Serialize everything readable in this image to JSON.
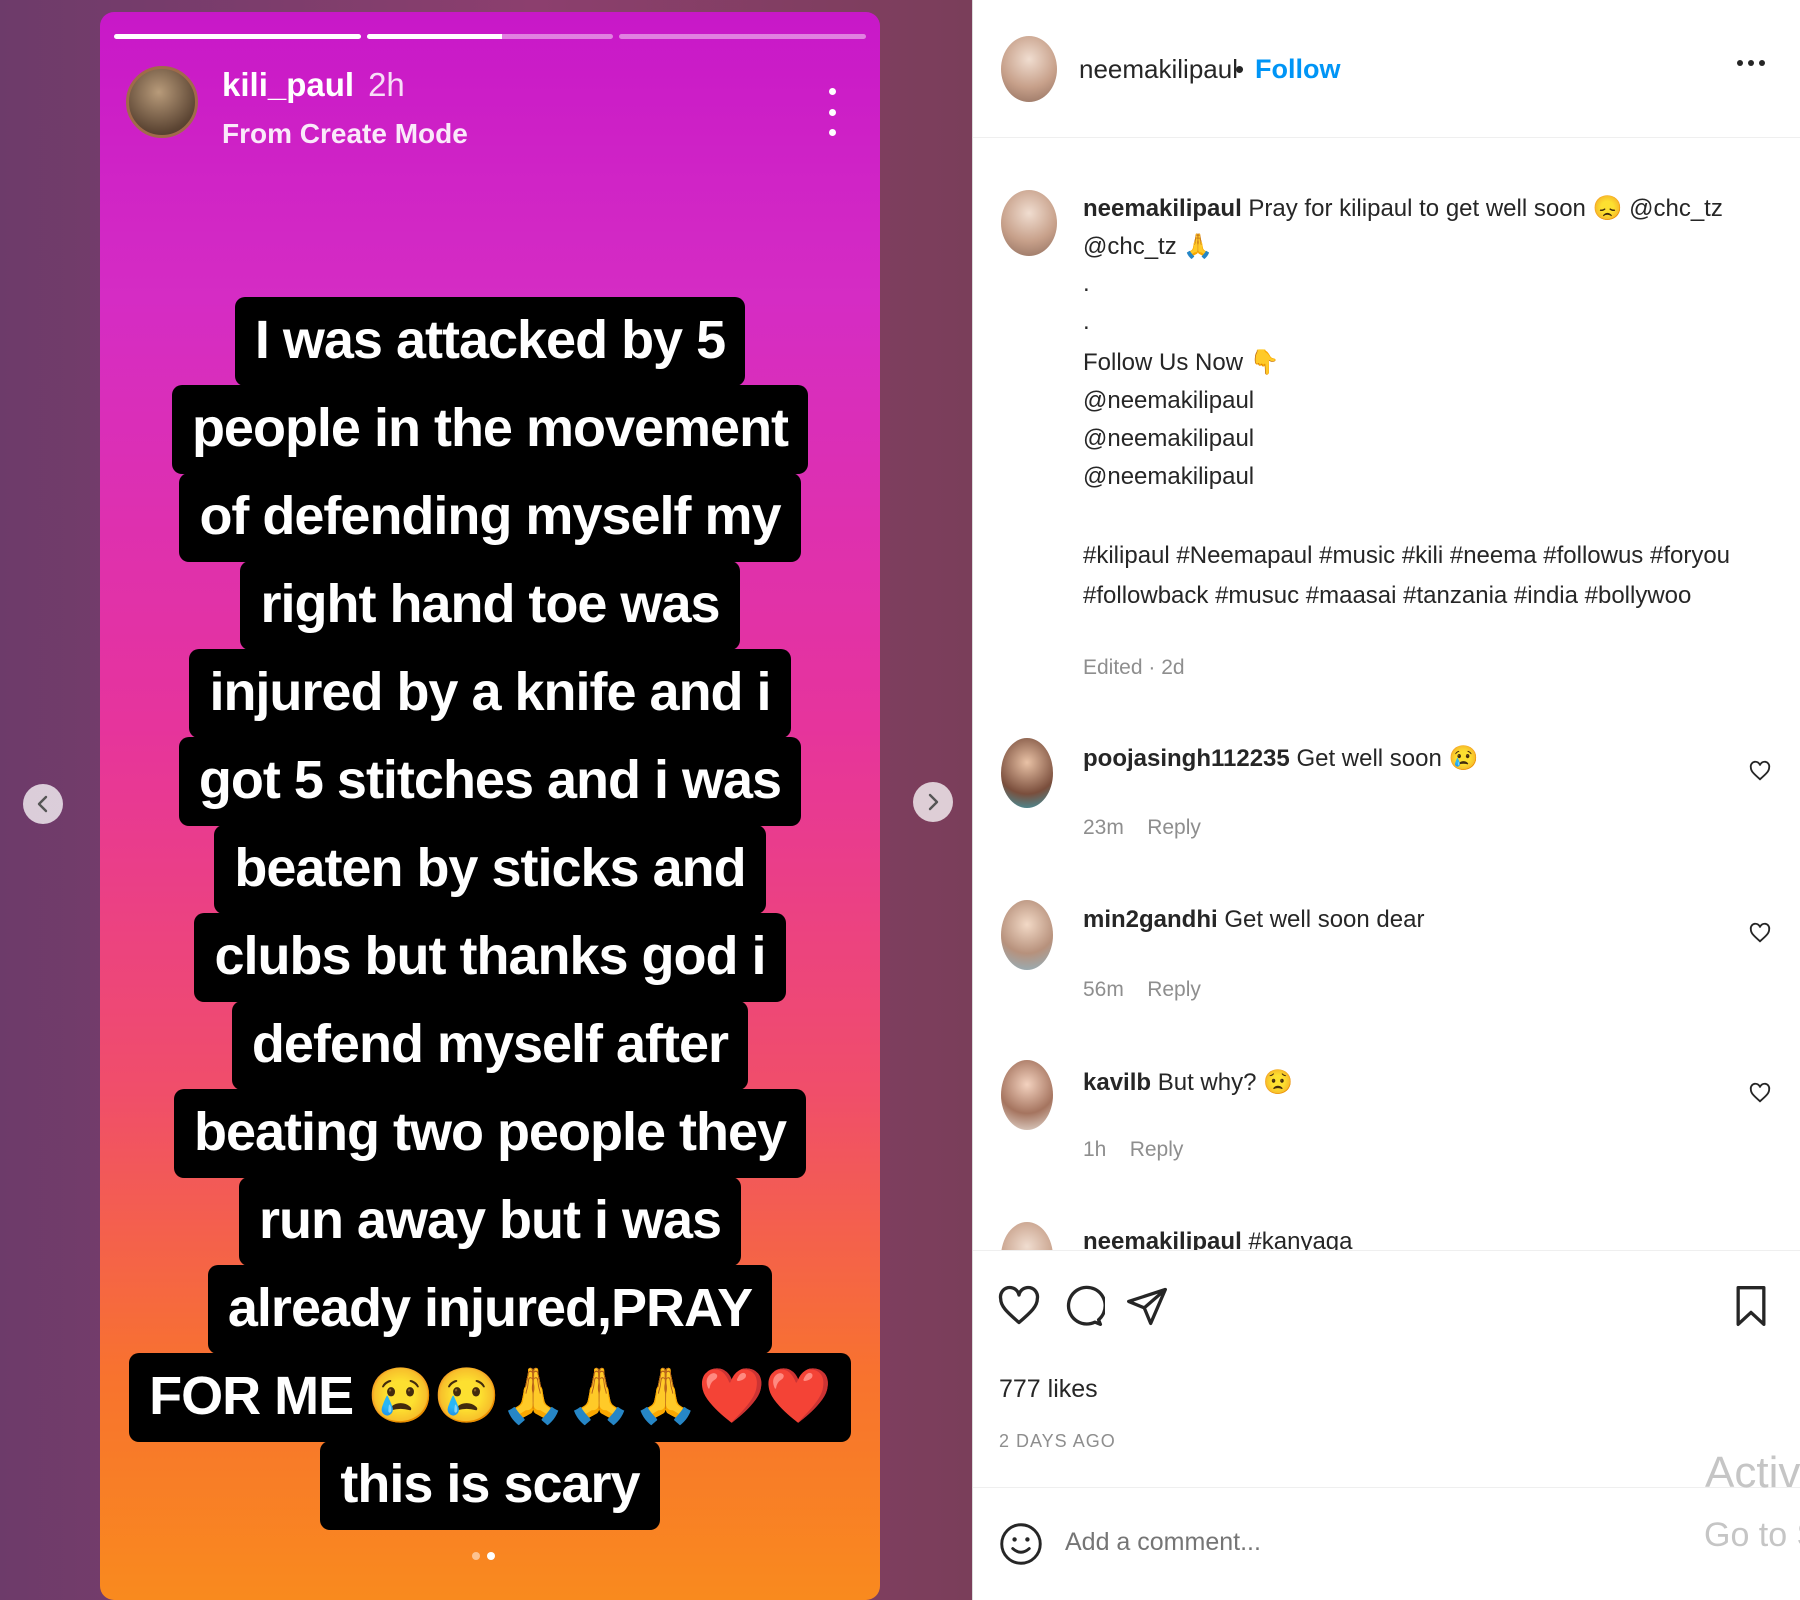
{
  "story": {
    "username": "kili_paul",
    "time": "2h",
    "mode": "From Create Mode",
    "progress": [
      1.0,
      0.55,
      0.0
    ],
    "lines": [
      "I was attacked by 5",
      "people in the movement",
      "of defending myself my",
      "right hand toe was",
      "injured by a knife and i",
      "got 5 stitches and i was",
      "beaten by sticks and",
      "clubs but thanks god i",
      "defend myself after",
      "beating two people they",
      "run away but i was",
      "already injured,PRAY",
      "FOR ME 😢😢🙏🙏🙏❤️❤️",
      "this is scary"
    ],
    "dots": 2,
    "active_dot": 1
  },
  "post": {
    "username": "neemakilipaul",
    "separator": "•",
    "follow_label": "Follow",
    "caption": {
      "user": "neemakilipaul",
      "line1": "Pray for kilipaul to get well soon 😞 @chc_tz",
      "line2": "@chc_tz 🙏",
      "dot1": ".",
      "dot2": ".",
      "follow_text": "Follow Us Now 👇",
      "mentions": [
        "@neemakilipaul",
        "@neemakilipaul",
        "@neemakilipaul"
      ],
      "hashtags1": "#kilipaul #Neemapaul #music #kili #neema #followus #foryou",
      "hashtags2": "#followback #musuc #maasai #tanzania #india #bollywoo",
      "edited": "Edited · 2d"
    },
    "comments": [
      {
        "user": "poojasingh112235",
        "text": "Get well soon 😢",
        "time": "23m",
        "reply": "Reply"
      },
      {
        "user": "min2gandhi",
        "text": "Get well soon dear",
        "time": "56m",
        "reply": "Reply"
      },
      {
        "user": "kavilb",
        "text": "But why? 😟",
        "time": "1h",
        "reply": "Reply"
      },
      {
        "user": "neemakilipaul",
        "text": "#kanyaga"
      }
    ],
    "likes": "777 likes",
    "date": "2 DAYS AGO",
    "add_comment_placeholder": "Add a comment..."
  },
  "watermark": {
    "line1": "Activ",
    "line2": "Go to S"
  },
  "colors": {
    "follow": "#0095f6",
    "story_gradient_top": "#c818c8",
    "story_gradient_bottom": "#f98a1e"
  },
  "icons": [
    "more-vertical-icon",
    "chevron-left-icon",
    "chevron-right-icon",
    "more-horizontal-icon",
    "heart-icon",
    "comment-icon",
    "share-icon",
    "bookmark-icon",
    "smile-icon"
  ]
}
